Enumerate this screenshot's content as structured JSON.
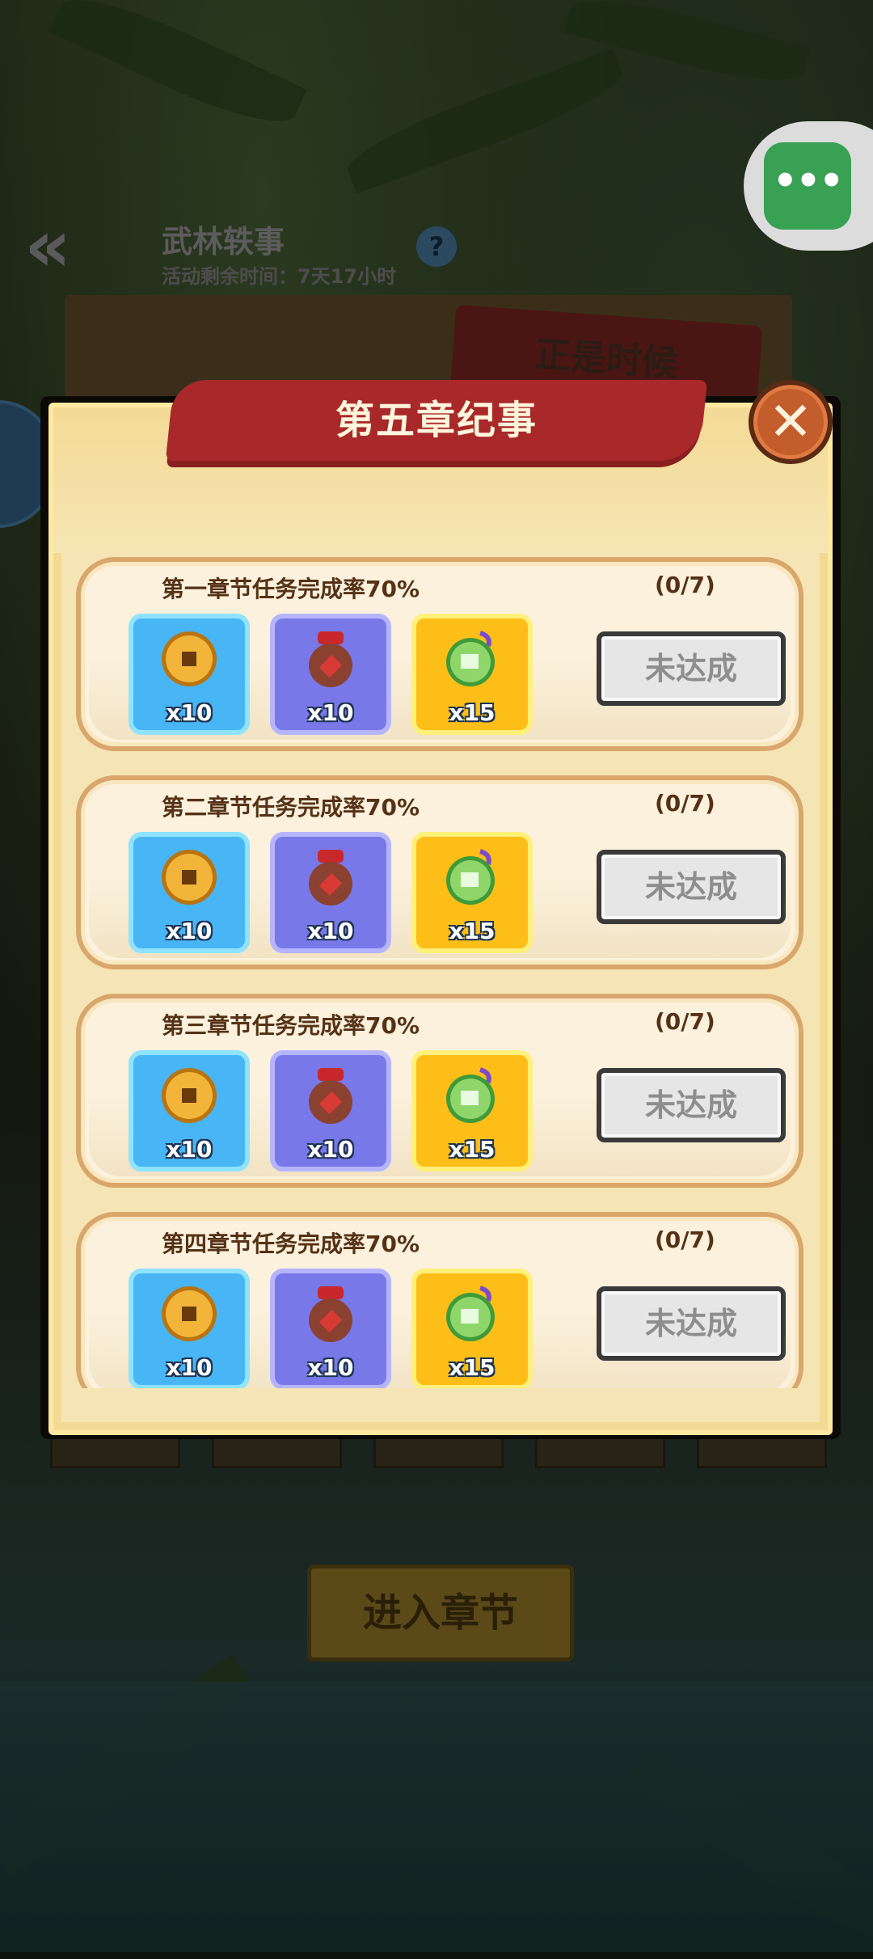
{
  "background": {
    "event_title": "武林轶事",
    "event_timer": "活动剩余时间：7天17小时",
    "help_label": "?",
    "banner_text": "正是时候",
    "enter_button_label": "进入章节"
  },
  "capsule": {
    "more_label": "•••"
  },
  "modal": {
    "title": "第五章纪事",
    "close_label": "✕",
    "tasks": [
      {
        "title": "第一章节任务完成率70%",
        "progress": "(0/7)",
        "rewards": [
          {
            "icon": "copper-coin-icon",
            "qty": "x10"
          },
          {
            "icon": "wine-jar-icon",
            "qty": "x10"
          },
          {
            "icon": "jade-pouch-icon",
            "qty": "x15"
          }
        ],
        "status": "未达成"
      },
      {
        "title": "第二章节任务完成率70%",
        "progress": "(0/7)",
        "rewards": [
          {
            "icon": "copper-coin-icon",
            "qty": "x10"
          },
          {
            "icon": "wine-jar-icon",
            "qty": "x10"
          },
          {
            "icon": "jade-pouch-icon",
            "qty": "x15"
          }
        ],
        "status": "未达成"
      },
      {
        "title": "第三章节任务完成率70%",
        "progress": "(0/7)",
        "rewards": [
          {
            "icon": "copper-coin-icon",
            "qty": "x10"
          },
          {
            "icon": "wine-jar-icon",
            "qty": "x10"
          },
          {
            "icon": "jade-pouch-icon",
            "qty": "x15"
          }
        ],
        "status": "未达成"
      },
      {
        "title": "第四章节任务完成率70%",
        "progress": "(0/7)",
        "rewards": [
          {
            "icon": "copper-coin-icon",
            "qty": "x10"
          },
          {
            "icon": "wine-jar-icon",
            "qty": "x10"
          },
          {
            "icon": "jade-pouch-icon",
            "qty": "x15"
          }
        ],
        "status": "未达成"
      }
    ]
  },
  "colors": {
    "modal_bg": "#f6e5b4",
    "banner_red": "#a9282a",
    "coin_tile": "#48b5f5",
    "wine_tile": "#7878e8",
    "jade_tile": "#fdbe18",
    "status_disabled": "#e6e6e6"
  }
}
